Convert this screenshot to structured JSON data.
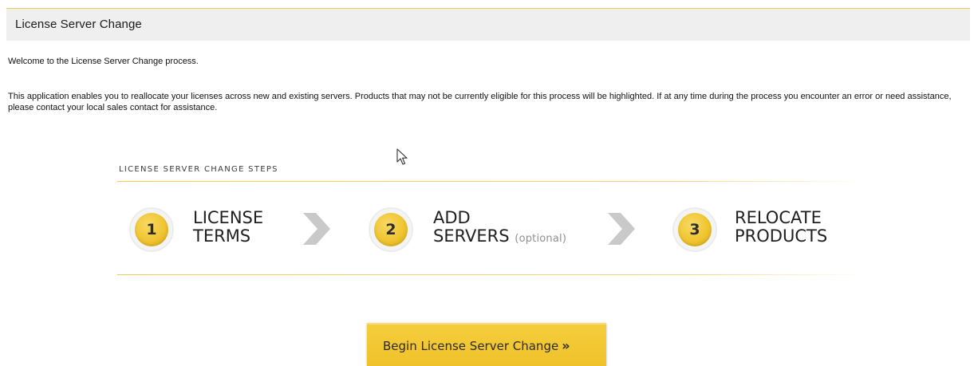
{
  "header": {
    "title": "License Server Change"
  },
  "intro": {
    "welcome": "Welcome to the License Server Change process.",
    "description": "This application enables you to reallocate your licenses across new and existing servers. Products that may not be currently eligible for this process will be highlighted. If at any time during the process you encounter an error or need assistance, please contact your local sales contact for assistance."
  },
  "steps": {
    "heading": "LICENSE SERVER CHANGE STEPS",
    "items": [
      {
        "number": "1",
        "line1": "LICENSE",
        "line2": "TERMS",
        "note": ""
      },
      {
        "number": "2",
        "line1": "ADD",
        "line2": "SERVERS",
        "note": "(optional)"
      },
      {
        "number": "3",
        "line1": "RELOCATE",
        "line2": "PRODUCTS",
        "note": ""
      }
    ]
  },
  "actions": {
    "begin_label": "Begin License Server Change",
    "begin_chevron": "»"
  },
  "colors": {
    "accent": "#f0c531",
    "header_bg": "#efefef",
    "rule": "#f0cc55",
    "arrow": "#c9c9c9"
  },
  "icons": {
    "cursor": "mouse-pointer-icon",
    "step_arrow": "chevron-right-icon"
  }
}
